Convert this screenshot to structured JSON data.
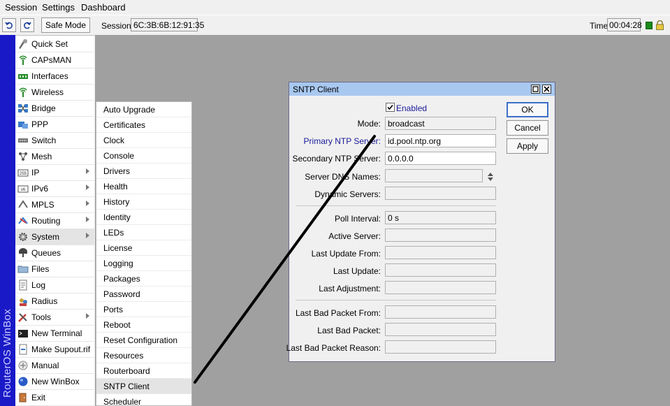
{
  "menubar": {
    "session": "Session",
    "settings": "Settings",
    "dashboard": "Dashboard"
  },
  "toolbar": {
    "undo_icon": "undo-icon",
    "redo_icon": "redo-icon",
    "safe_mode": "Safe Mode",
    "session_label": "Session:",
    "session_value": "6C:3B:6B:12:91:35",
    "time_label": "Time:",
    "time_value": "00:04:28"
  },
  "brand": "RouterOS WinBox",
  "sidebar": {
    "items": [
      {
        "label": "Quick Set",
        "icon": "quickset-icon",
        "submenu": false
      },
      {
        "label": "CAPsMAN",
        "icon": "antenna-icon",
        "submenu": false
      },
      {
        "label": "Interfaces",
        "icon": "interfaces-icon",
        "submenu": false
      },
      {
        "label": "Wireless",
        "icon": "antenna-icon",
        "submenu": false
      },
      {
        "label": "Bridge",
        "icon": "bridge-icon",
        "submenu": false
      },
      {
        "label": "PPP",
        "icon": "ppp-icon",
        "submenu": false
      },
      {
        "label": "Switch",
        "icon": "switch-icon",
        "submenu": false
      },
      {
        "label": "Mesh",
        "icon": "mesh-icon",
        "submenu": false
      },
      {
        "label": "IP",
        "icon": "ip-icon",
        "submenu": true
      },
      {
        "label": "IPv6",
        "icon": "ipv6-icon",
        "submenu": true
      },
      {
        "label": "MPLS",
        "icon": "mpls-icon",
        "submenu": true
      },
      {
        "label": "Routing",
        "icon": "routing-icon",
        "submenu": true
      },
      {
        "label": "System",
        "icon": "gear-icon",
        "submenu": true
      },
      {
        "label": "Queues",
        "icon": "queues-icon",
        "submenu": false
      },
      {
        "label": "Files",
        "icon": "folder-icon",
        "submenu": false
      },
      {
        "label": "Log",
        "icon": "log-icon",
        "submenu": false
      },
      {
        "label": "Radius",
        "icon": "radius-icon",
        "submenu": false
      },
      {
        "label": "Tools",
        "icon": "tools-icon",
        "submenu": true
      },
      {
        "label": "New Terminal",
        "icon": "terminal-icon",
        "submenu": false
      },
      {
        "label": "Make Supout.rif",
        "icon": "supout-icon",
        "submenu": false
      },
      {
        "label": "Manual",
        "icon": "manual-icon",
        "submenu": false
      },
      {
        "label": "New WinBox",
        "icon": "winbox-icon",
        "submenu": false
      },
      {
        "label": "Exit",
        "icon": "exit-icon",
        "submenu": false
      }
    ]
  },
  "system_menu": {
    "items": [
      "Auto Upgrade",
      "Certificates",
      "Clock",
      "Console",
      "Drivers",
      "Health",
      "History",
      "Identity",
      "LEDs",
      "License",
      "Logging",
      "Packages",
      "Password",
      "Ports",
      "Reboot",
      "Reset Configuration",
      "Resources",
      "Routerboard",
      "SNTP Client",
      "Scheduler"
    ]
  },
  "dialog": {
    "title": "SNTP Client",
    "enabled_label": "Enabled",
    "enabled": true,
    "fields": {
      "mode": {
        "label": "Mode:",
        "value": "broadcast"
      },
      "primary": {
        "label": "Primary NTP Server:",
        "value": "id.pool.ntp.org"
      },
      "secondary": {
        "label": "Secondary NTP Server:",
        "value": "0.0.0.0"
      },
      "dns_names": {
        "label": "Server DNS Names:",
        "value": ""
      },
      "dynamic": {
        "label": "Dynamic Servers:",
        "value": ""
      },
      "poll": {
        "label": "Poll Interval:",
        "value": "0 s"
      },
      "active": {
        "label": "Active Server:",
        "value": ""
      },
      "last_update_from": {
        "label": "Last Update From:",
        "value": ""
      },
      "last_update": {
        "label": "Last Update:",
        "value": ""
      },
      "last_adjust": {
        "label": "Last Adjustment:",
        "value": ""
      },
      "bad_from": {
        "label": "Last Bad Packet From:",
        "value": ""
      },
      "bad": {
        "label": "Last Bad Packet:",
        "value": ""
      },
      "bad_reason": {
        "label": "Last Bad Packet Reason:",
        "value": ""
      }
    },
    "buttons": {
      "ok": "OK",
      "cancel": "Cancel",
      "apply": "Apply"
    }
  },
  "colors": {
    "brand_bar": "#1919c8",
    "title_bar": "#a8c8f0",
    "desktop": "#a0a0a0",
    "link_label": "#1a1a99"
  }
}
